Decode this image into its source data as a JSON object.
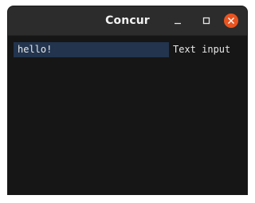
{
  "window": {
    "title": "Concur",
    "controls": {
      "minimize_icon": "minimize-icon",
      "maximize_icon": "maximize-icon",
      "close_icon": "close-icon",
      "close_color": "#e95420"
    }
  },
  "main": {
    "text_input": {
      "value": "hello!",
      "label": "Text input"
    }
  },
  "colors": {
    "titlebar": "#2c2c2c",
    "background": "#161616",
    "input_background": "#22344e",
    "text": "#e8e8e8"
  }
}
